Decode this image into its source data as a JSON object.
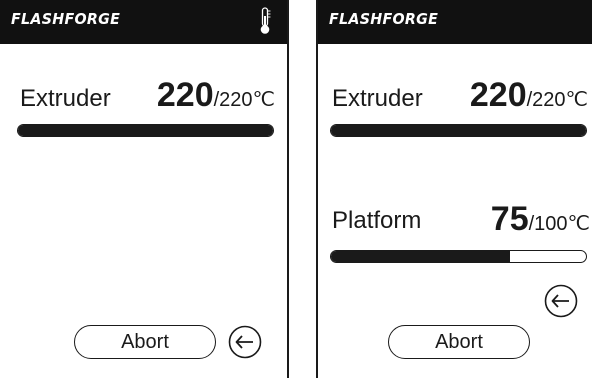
{
  "left_screen": {
    "brand": "FLASHFORGE",
    "header_icon": "thermometer-icon",
    "extruder": {
      "label": "Extruder",
      "current": "220",
      "target": "/220℃",
      "progress": 1.0
    },
    "abort_label": "Abort",
    "back_icon": "back-arrow-icon"
  },
  "right_screen": {
    "brand": "FLASHFORGE",
    "extruder": {
      "label": "Extruder",
      "current": "220",
      "target": "/220℃",
      "progress": 1.0
    },
    "platform": {
      "label": "Platform",
      "current": "75",
      "target": "/100℃",
      "progress": 0.7
    },
    "abort_label": "Abort",
    "back_icon": "back-arrow-icon"
  },
  "colors": {
    "header_bg": "#111111",
    "foreground": "#1a1a1a",
    "background": "#ffffff"
  }
}
